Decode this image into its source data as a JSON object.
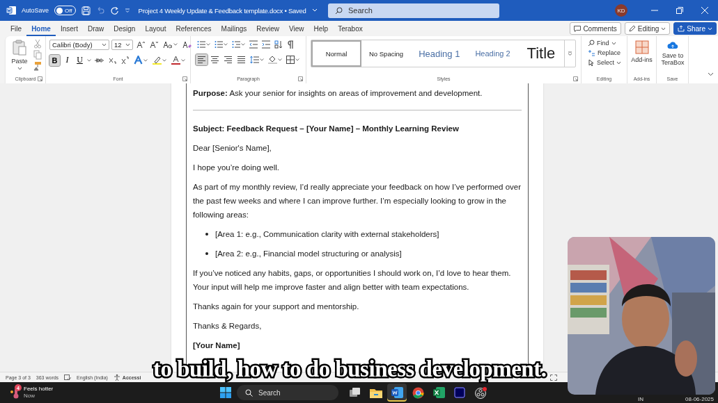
{
  "title_bar": {
    "autosave_label": "AutoSave",
    "autosave": {
      "on": false,
      "label": "Off"
    },
    "document_title": "Project 4 Weekly Update & Feedback template.docx • Saved",
    "search_placeholder": "Search",
    "avatar": "KD"
  },
  "menu_tabs": [
    {
      "label": "File",
      "selected": false
    },
    {
      "label": "Home",
      "selected": true
    },
    {
      "label": "Insert",
      "selected": false
    },
    {
      "label": "Draw",
      "selected": false
    },
    {
      "label": "Design",
      "selected": false
    },
    {
      "label": "Layout",
      "selected": false
    },
    {
      "label": "References",
      "selected": false
    },
    {
      "label": "Mailings",
      "selected": false
    },
    {
      "label": "Review",
      "selected": false
    },
    {
      "label": "View",
      "selected": false
    },
    {
      "label": "Help",
      "selected": false
    },
    {
      "label": "Terabox",
      "selected": false
    }
  ],
  "header_buttons": [
    {
      "kind": "comments",
      "label": "Comments"
    },
    {
      "kind": "editing",
      "label": "Editing"
    },
    {
      "kind": "share",
      "label": "Share"
    }
  ],
  "ribbon": {
    "clipboard": {
      "paste": "Paste",
      "label": "Clipboard"
    },
    "font": {
      "name": "Calibri (Body)",
      "size": "12",
      "label": "Font",
      "format_buttons": [
        {
          "label": "B",
          "selected": true
        },
        {
          "label": "I",
          "selected": false
        },
        {
          "label": "U",
          "selected": false
        }
      ]
    },
    "paragraph": {
      "label": "Paragraph",
      "alignment": [
        {
          "kind": "left",
          "selected": true
        },
        {
          "kind": "center",
          "selected": false
        },
        {
          "kind": "right",
          "selected": false
        },
        {
          "kind": "justify",
          "selected": false
        }
      ]
    },
    "styles": {
      "label": "Styles",
      "items": [
        {
          "kind": "normal",
          "label": "Normal",
          "selected": true
        },
        {
          "kind": "no_spacing",
          "label": "No Spacing",
          "selected": false
        },
        {
          "kind": "heading1",
          "label": "Heading 1",
          "selected": false
        },
        {
          "kind": "heading2",
          "label": "Heading 2",
          "selected": false
        },
        {
          "kind": "title",
          "label": "Title",
          "selected": false
        }
      ]
    },
    "editing": {
      "label": "Editing",
      "items": [
        {
          "kind": "find",
          "label": "Find"
        },
        {
          "kind": "replace",
          "label": "Replace"
        },
        {
          "kind": "select",
          "label": "Select"
        }
      ]
    },
    "addins": {
      "button": "Add-ins",
      "label": "Add-ins"
    },
    "save": {
      "button": "Save to TeraBox",
      "label": "Save"
    }
  },
  "document": {
    "blocks": [
      {
        "kind": "paragraph",
        "text": "**Purpose:** Ask your senior for insights on areas of improvement and development."
      },
      {
        "kind": "rule"
      },
      {
        "kind": "heading",
        "text": "Subject: Feedback Request – [Your Name] – Monthly Learning Review"
      },
      {
        "kind": "paragraph",
        "text": "Dear [Senior's Name],"
      },
      {
        "kind": "paragraph",
        "text": "I hope you’re doing well."
      },
      {
        "kind": "paragraph",
        "text": "As part of my monthly review, I’d really appreciate your feedback on how I’ve performed over the past few weeks and where I can improve further. I’m especially looking to grow in the following areas:"
      },
      {
        "kind": "bullet",
        "text": "[Area 1: e.g., Communication clarity with external stakeholders]"
      },
      {
        "kind": "bullet",
        "text": "[Area 2: e.g., Financial model structuring or analysis]"
      },
      {
        "kind": "paragraph",
        "text": "If you’ve noticed any habits, gaps, or opportunities I should work on, I’d love to hear them. Your input will help me improve faster and align better with team expectations."
      },
      {
        "kind": "paragraph",
        "text": "Thanks again for your support and mentorship."
      },
      {
        "kind": "paragraph",
        "text": "Thanks & Regards,"
      },
      {
        "kind": "heading",
        "text": "[Your Name]"
      }
    ]
  },
  "status_bar": {
    "items": [
      {
        "kind": "text",
        "text": "Page 3 of 3"
      },
      {
        "kind": "text",
        "text": "363 words"
      },
      {
        "kind": "proofing"
      },
      {
        "kind": "text",
        "text": "English (India)"
      },
      {
        "kind": "accessibility"
      },
      {
        "kind": "strong",
        "text": "Accessi"
      },
      {
        "kind": "focus"
      }
    ]
  },
  "taskbar": {
    "weather": {
      "badge": "4",
      "title": "Feels hotter",
      "subtitle": "Now"
    },
    "search_placeholder": "Search",
    "apps": [
      {
        "kind": "task_view",
        "selected": false
      },
      {
        "kind": "file_explorer",
        "selected": false
      },
      {
        "kind": "word",
        "selected": true
      },
      {
        "kind": "chrome",
        "selected": false
      },
      {
        "kind": "excel",
        "selected": false
      },
      {
        "kind": "premiere",
        "selected": false
      },
      {
        "kind": "obs",
        "selected": false
      }
    ],
    "tray": [
      "IN",
      "08-06-2025"
    ]
  },
  "caption": "to build, how to do business development."
}
